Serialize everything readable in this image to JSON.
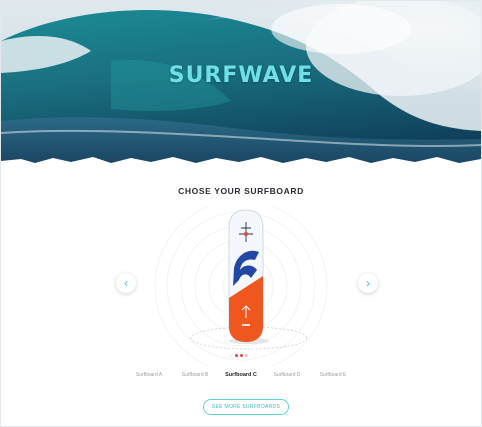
{
  "brand": {
    "title": "SURFWAVE",
    "color": "#6fe0e6"
  },
  "section": {
    "heading": "CHOSE YOUR SURFBOARD"
  },
  "carousel": {
    "prev_icon": "chevron-left-icon",
    "next_icon": "chevron-right-icon",
    "prev_glyph": "‹",
    "next_glyph": "›",
    "dots_total": 3,
    "dots_active": 1,
    "board": {
      "accent": "#f0571f",
      "blue": "#2348a3",
      "base": "#f4f7fb"
    }
  },
  "tabs": [
    {
      "label": "Surfboard A",
      "active": false
    },
    {
      "label": "Surfboard B",
      "active": false
    },
    {
      "label": "Surfboard C",
      "active": true
    },
    {
      "label": "Surfboard D",
      "active": false
    },
    {
      "label": "Surfboard E",
      "active": false
    }
  ],
  "cta": {
    "label": "SEE MORE SURFBOARDS",
    "color": "#5fd2d6"
  }
}
